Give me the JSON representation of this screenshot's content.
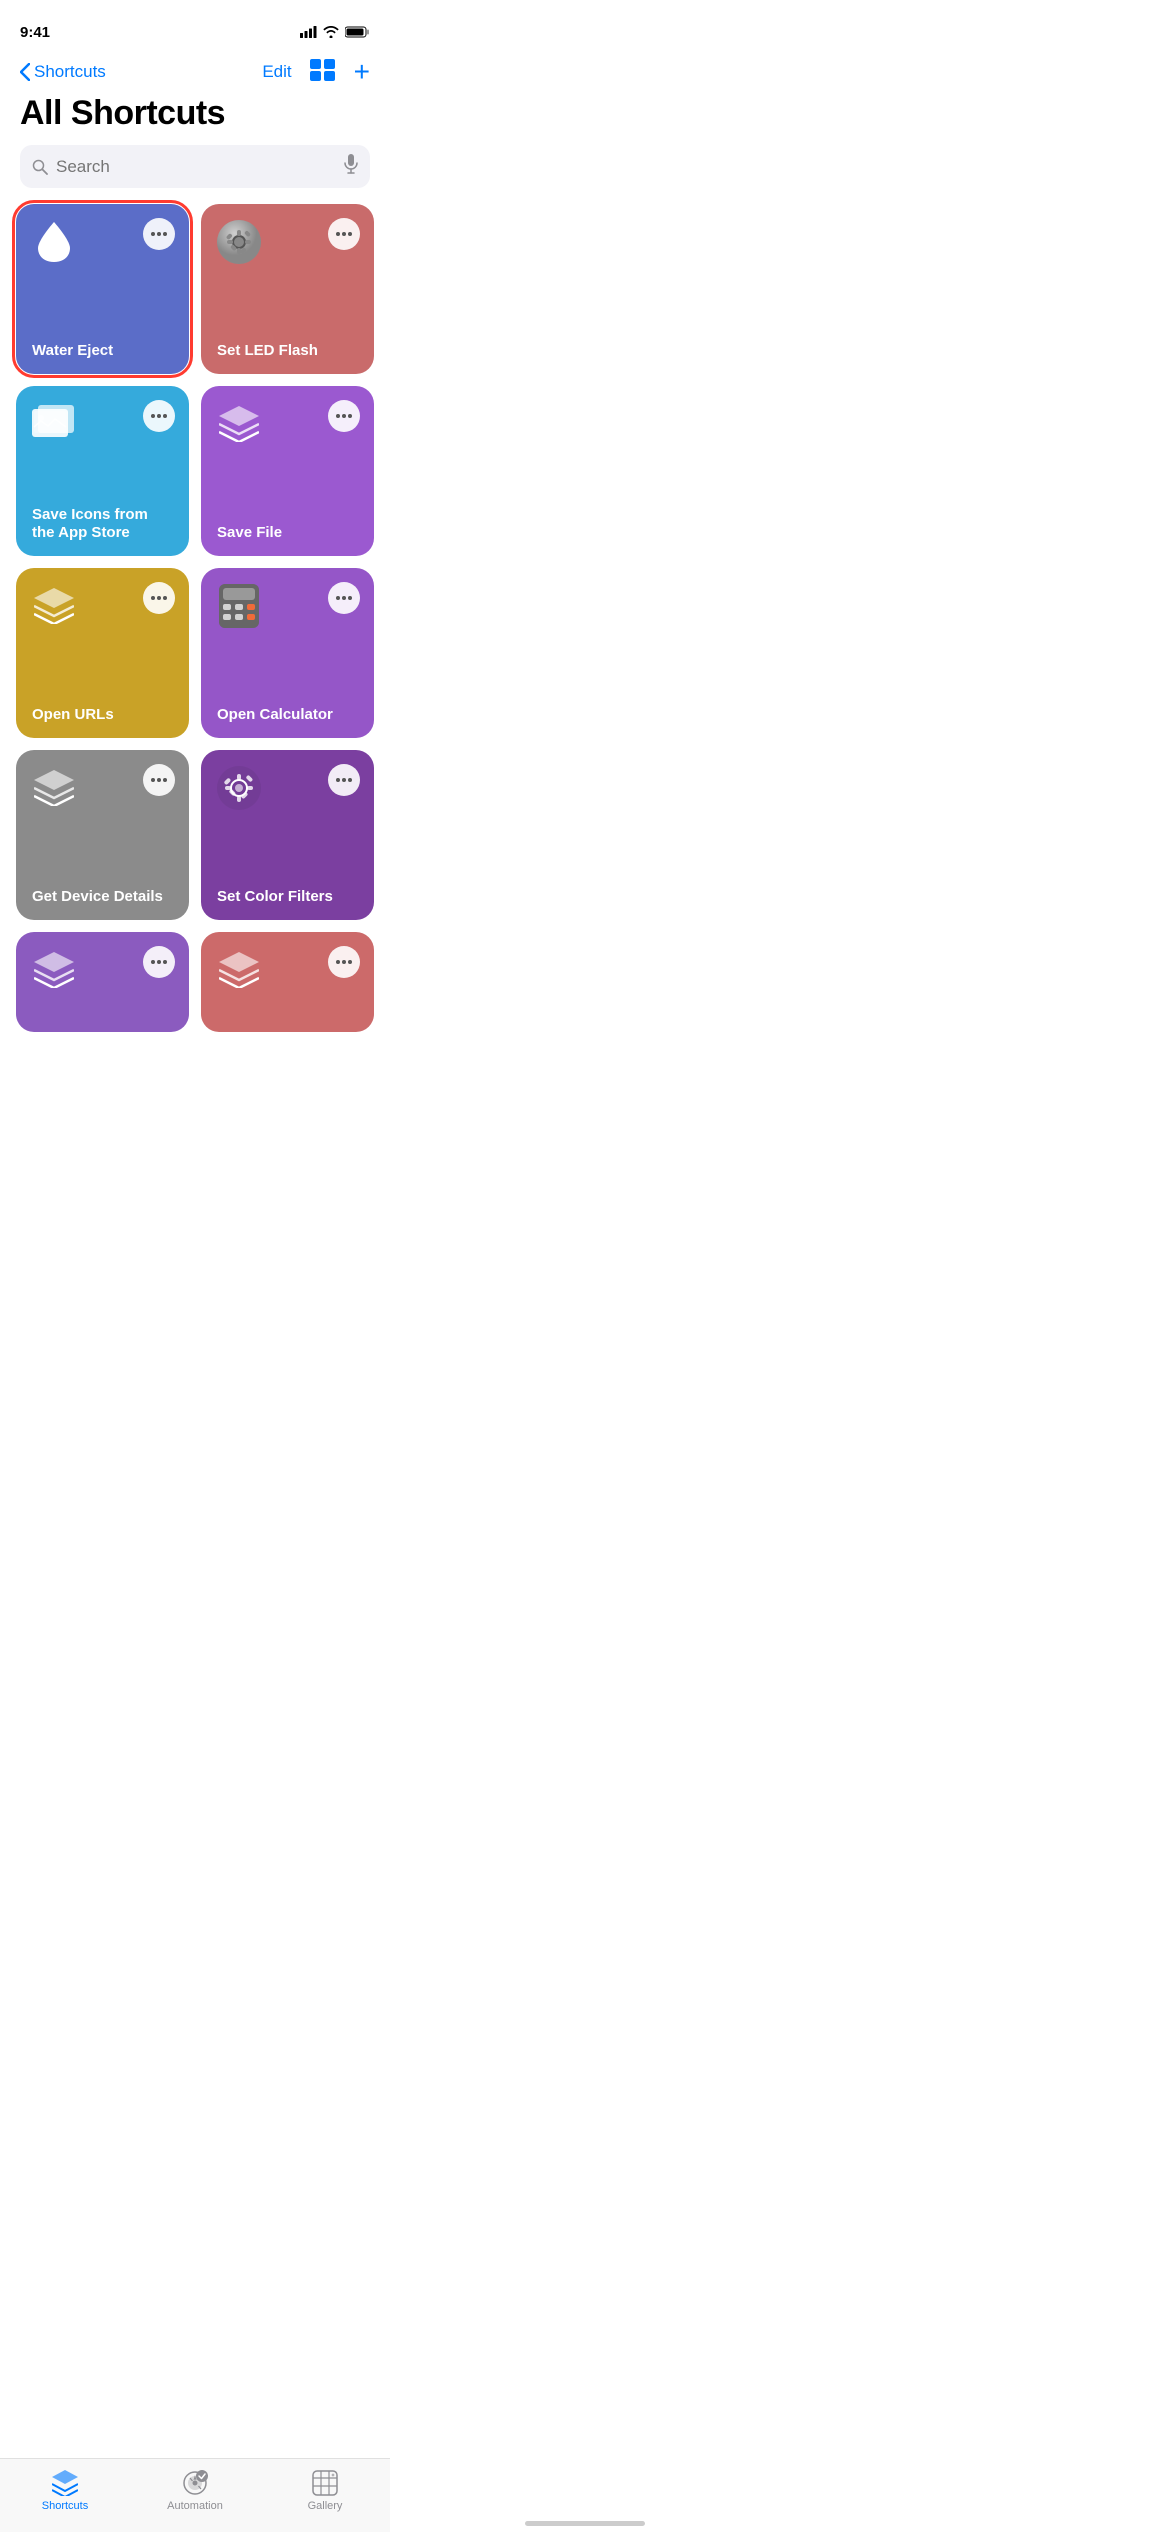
{
  "statusBar": {
    "time": "9:41",
    "signal": "signal-icon",
    "wifi": "wifi-icon",
    "battery": "battery-icon"
  },
  "nav": {
    "backLabel": "Shortcuts",
    "editLabel": "Edit",
    "gridIcon": "grid-icon",
    "addIcon": "+"
  },
  "pageTitle": "All Shortcuts",
  "search": {
    "placeholder": "Search",
    "searchIcon": "search-icon",
    "micIcon": "mic-icon"
  },
  "shortcuts": [
    {
      "id": 1,
      "name": "Water Eject",
      "color": "card-blue",
      "icon": "water-drop",
      "selected": true
    },
    {
      "id": 2,
      "name": "Set LED Flash",
      "color": "card-red-pink",
      "icon": "settings-gear",
      "selected": false
    },
    {
      "id": 3,
      "name": "Save Icons from the App Store",
      "color": "card-cyan",
      "icon": "photo-frame",
      "selected": false
    },
    {
      "id": 4,
      "name": "Save File",
      "color": "card-purple",
      "icon": "layers",
      "selected": false
    },
    {
      "id": 5,
      "name": "Open URLs",
      "color": "card-yellow",
      "icon": "layers",
      "selected": false
    },
    {
      "id": 6,
      "name": "Open Calculator",
      "color": "card-purple2",
      "icon": "calculator",
      "selected": false
    },
    {
      "id": 7,
      "name": "Get Device Details",
      "color": "card-gray",
      "icon": "layers",
      "selected": false
    },
    {
      "id": 8,
      "name": "Set Color Filters",
      "color": "card-dark-purple",
      "icon": "settings-gear",
      "selected": false
    },
    {
      "id": 9,
      "name": "",
      "color": "card-purple3",
      "icon": "layers",
      "selected": false
    },
    {
      "id": 10,
      "name": "",
      "color": "card-salmon",
      "icon": "layers",
      "selected": false
    }
  ],
  "tabs": [
    {
      "id": "shortcuts",
      "label": "Shortcuts",
      "active": true,
      "icon": "shortcuts-tab-icon"
    },
    {
      "id": "automation",
      "label": "Automation",
      "active": false,
      "icon": "automation-tab-icon"
    },
    {
      "id": "gallery",
      "label": "Gallery",
      "active": false,
      "icon": "gallery-tab-icon"
    }
  ]
}
